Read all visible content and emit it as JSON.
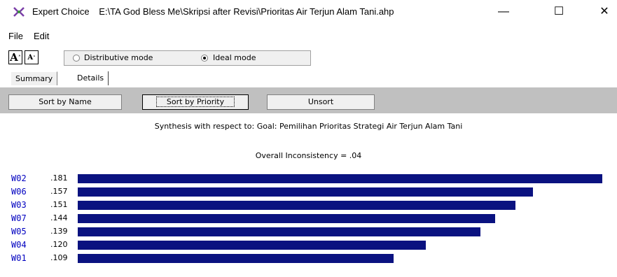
{
  "window": {
    "app_name": "Expert Choice",
    "file_path": "E:\\TA God Bless Me\\Skripsi after Revisi\\Prioritas Air Terjun Alam Tani.ahp",
    "minimize_glyph": "—",
    "maximize_glyph": "☐",
    "close_glyph": "✕"
  },
  "menu": {
    "file": "File",
    "edit": "Edit"
  },
  "toolbar": {
    "font_larger": "A",
    "font_smaller": "A",
    "distributive_label": "Distributive mode",
    "ideal_label": "Ideal mode",
    "selected_mode": "ideal"
  },
  "tabs": {
    "summary": "Summary",
    "details": "Details",
    "active": "summary"
  },
  "buttons": {
    "sort_by_name": "Sort by Name",
    "sort_by_priority": "Sort by Priority",
    "unsort": "Unsort"
  },
  "synthesis_title": "Synthesis with respect to: Goal: Pemilihan Prioritas Strategi Air Terjun Alam Tani",
  "inconsistency": "Overall Inconsistency = .04",
  "colors": {
    "bar": "#0a1280",
    "name_text": "#0000c0",
    "panel": "#c0c0c0"
  },
  "chart_data": {
    "type": "bar",
    "categories": [
      "W02",
      "W06",
      "W03",
      "W07",
      "W05",
      "W04",
      "W01"
    ],
    "values": [
      0.181,
      0.157,
      0.151,
      0.144,
      0.139,
      0.12,
      0.109
    ],
    "value_labels": [
      ".181",
      ".157",
      ".151",
      ".144",
      ".139",
      ".120",
      ".109"
    ],
    "orientation": "horizontal"
  }
}
